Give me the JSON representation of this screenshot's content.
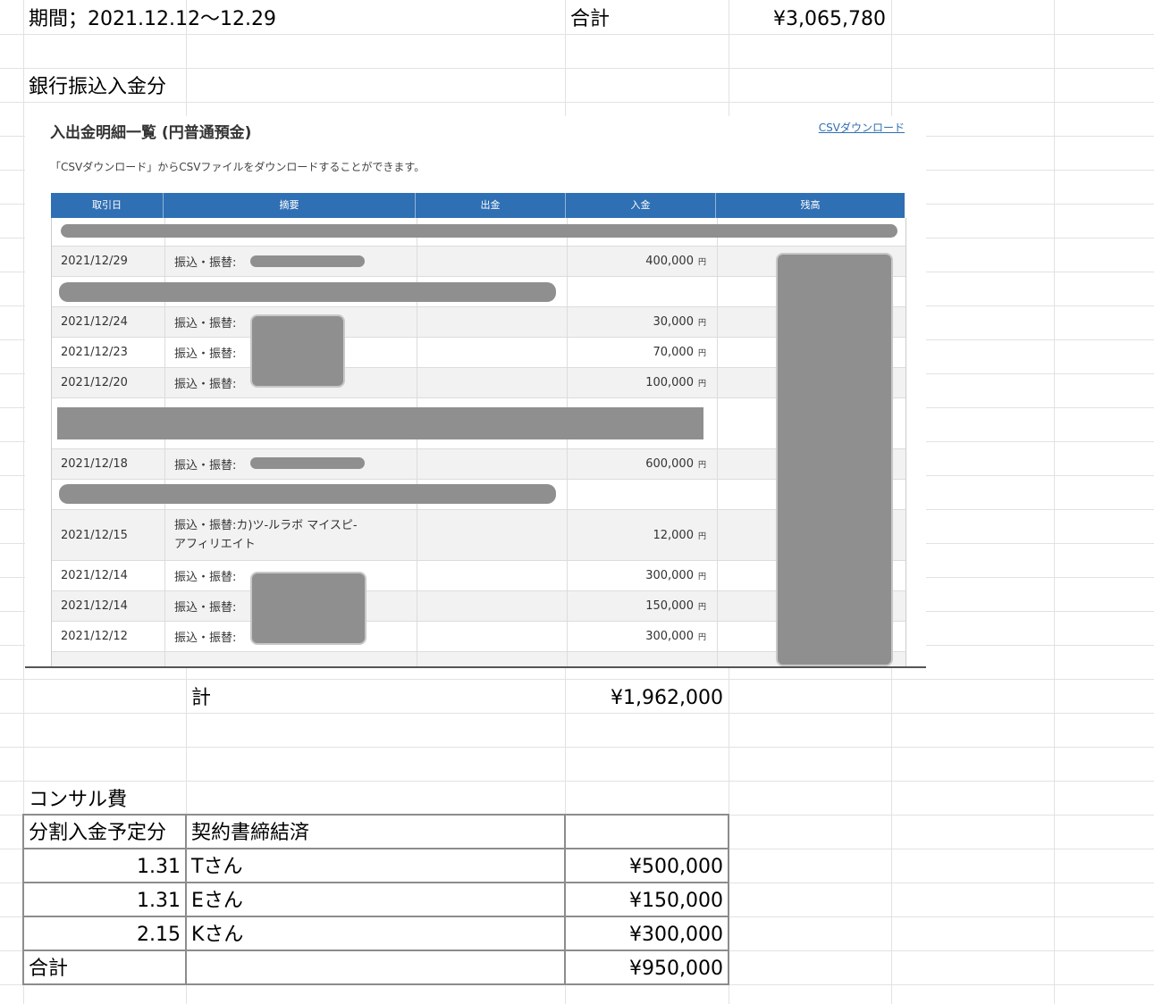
{
  "header": {
    "period": "期間；2021.12.12〜12.29",
    "total_label": "合計",
    "total_value": "¥3,065,780"
  },
  "bank_section": {
    "heading": "銀行振込入金分",
    "screenshot": {
      "title": "入出金明細一覧 (円普通預金)",
      "csv_link": "CSVダウンロード",
      "note": "「CSVダウンロード」からCSVファイルをダウンロードすることができます。",
      "columns": [
        "取引日",
        "摘要",
        "出金",
        "入金",
        "残高"
      ],
      "yen_unit": "円",
      "rows": [
        {
          "date": "2021/12/29",
          "desc": "振込・振替:",
          "deposit": "400,000"
        },
        {
          "date": "2021/12/24",
          "desc": "振込・振替:",
          "deposit": "30,000"
        },
        {
          "date": "2021/12/23",
          "desc": "振込・振替:",
          "deposit": "70,000"
        },
        {
          "date": "2021/12/20",
          "desc": "振込・振替:",
          "deposit": "100,000"
        },
        {
          "date": "2021/12/18",
          "desc": "振込・振替:",
          "deposit": "600,000"
        },
        {
          "date": "2021/12/15",
          "desc": "振込・振替:カ)ツ-ルラボ マイスピ-",
          "desc2": "アフィリエイト",
          "deposit": "12,000"
        },
        {
          "date": "2021/12/14",
          "desc": "振込・振替:",
          "deposit": "300,000"
        },
        {
          "date": "2021/12/14",
          "desc": "振込・振替:",
          "deposit": "150,000"
        },
        {
          "date": "2021/12/12",
          "desc": "振込・振替:",
          "deposit": "300,000"
        }
      ]
    },
    "subtotal_label": "計",
    "subtotal_value": "¥1,962,000"
  },
  "consulting": {
    "heading": "コンサル費",
    "col1_header": "分割入金予定分",
    "col2_header": "契約書締結済",
    "rows": [
      {
        "date": "1.31",
        "name": "Tさん",
        "amount": "¥500,000"
      },
      {
        "date": "1.31",
        "name": "Eさん",
        "amount": "¥150,000"
      },
      {
        "date": "2.15",
        "name": "Kさん",
        "amount": "¥300,000"
      }
    ],
    "total_label": "合計",
    "total_value": "¥950,000"
  }
}
